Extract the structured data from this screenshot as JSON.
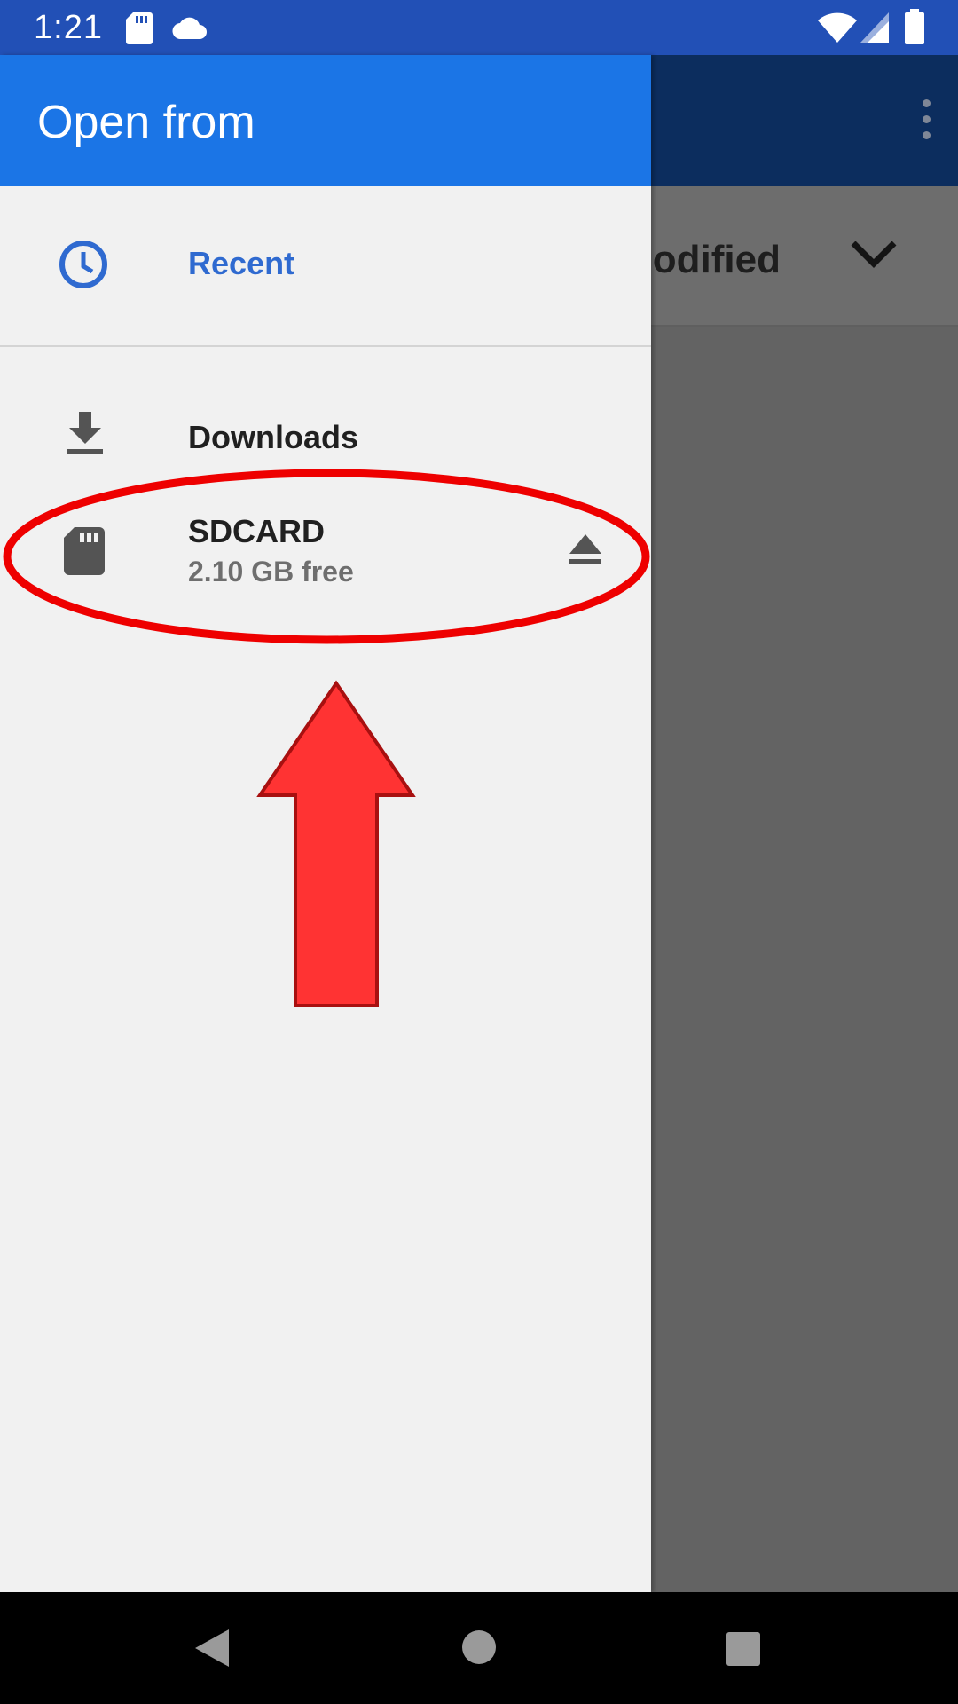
{
  "status_bar": {
    "time": "1:21",
    "icons": [
      "sd-card-icon",
      "cloud-icon",
      "wifi-icon",
      "signal-icon",
      "battery-icon"
    ]
  },
  "background_app": {
    "sort_label": "odified",
    "icons": [
      "overflow-menu-icon",
      "chevron-down-icon"
    ]
  },
  "drawer": {
    "title": "Open from",
    "items": [
      {
        "label": "Recent",
        "icon": "clock-icon",
        "color": "#2f6ad0"
      },
      {
        "label": "Downloads",
        "icon": "download-icon"
      },
      {
        "label": "SDCARD",
        "sublabel": "2.10 GB free",
        "icon": "sd-card-icon",
        "action_icon": "eject-icon"
      }
    ]
  },
  "annotation": {
    "ellipse_color": "#ee0000",
    "arrow_fill": "#ff3333",
    "arrow_stroke": "#a81010"
  },
  "nav_bar": {
    "icons": [
      "back-icon",
      "home-icon",
      "recents-icon"
    ]
  },
  "colors": {
    "status_bar": "#2250b6",
    "drawer_header": "#1b75e6",
    "scrim_toolbar": "#0c2d5e",
    "scrim": "#636363"
  }
}
